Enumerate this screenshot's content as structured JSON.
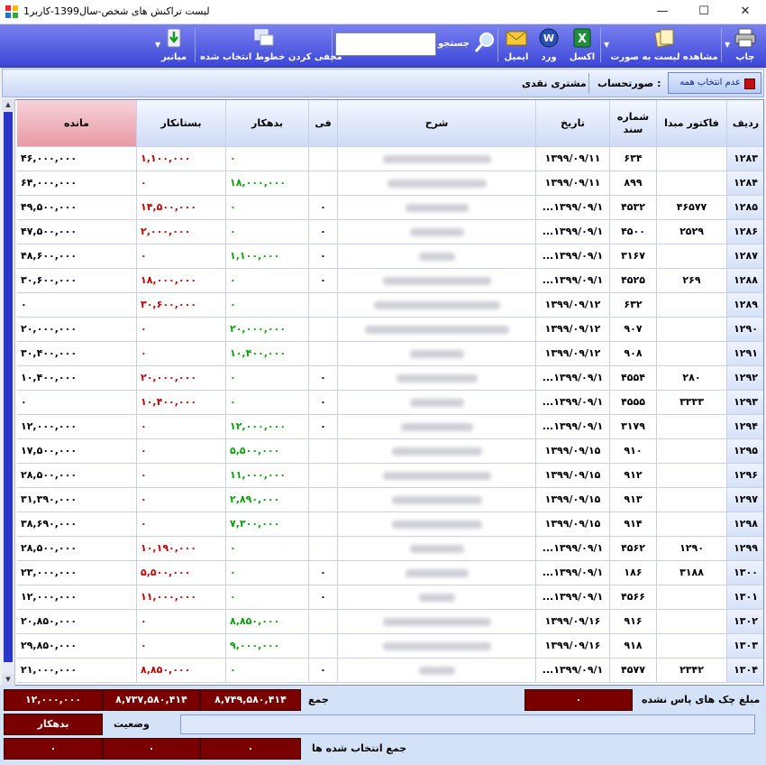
{
  "window": {
    "title": "لیست تراکنش های شخص-سال1399-کاربر1"
  },
  "toolbar": {
    "print": "چاپ",
    "view_list": "مشاهده لیست به صورت",
    "excel": "اکسل",
    "word": "ورد",
    "email": "ایمیل",
    "search_label": "جستجو",
    "search_value": "",
    "hide_selected": "مخفی کردن خطوط انتخاب شده",
    "shortcut": "میانبر"
  },
  "account": {
    "deselect_all": "عدم انتخاب همه",
    "label": "صورتحساب :",
    "value": "مشتری نقدی"
  },
  "table": {
    "headers": {
      "row": "ردیف",
      "factor": "فاکتور مبدا",
      "doc": "شماره سند",
      "date": "تاریخ",
      "desc": "شرح",
      "fee": "فی",
      "debit": "بدهکار",
      "credit": "بستانکار",
      "balance": "مانده"
    },
    "rows": [
      {
        "row": "۱۲۸۳",
        "factor": "",
        "doc": "۶۳۴",
        "date": "۱۳۹۹/۰۹/۱۱",
        "fee": "",
        "debit": "۰",
        "credit": "۱,۱۰۰,۰۰۰",
        "balance": "۴۶,۰۰۰,۰۰۰"
      },
      {
        "row": "۱۲۸۴",
        "factor": "",
        "doc": "۸۹۹",
        "date": "۱۳۹۹/۰۹/۱۱",
        "fee": "",
        "debit": "۱۸,۰۰۰,۰۰۰",
        "credit": "۰",
        "balance": "۶۴,۰۰۰,۰۰۰"
      },
      {
        "row": "۱۲۸۵",
        "factor": "۴۶۵۷۷",
        "doc": "۴۵۳۲",
        "date": "...۱۳۹۹/۰۹/۱",
        "fee": "۰",
        "debit": "۰",
        "credit": "۱۴,۵۰۰,۰۰۰",
        "balance": "۴۹,۵۰۰,۰۰۰"
      },
      {
        "row": "۱۲۸۶",
        "factor": "۲۵۲۹",
        "doc": "۴۵۰۰",
        "date": "...۱۳۹۹/۰۹/۱",
        "fee": "۰",
        "debit": "۰",
        "credit": "۲,۰۰۰,۰۰۰",
        "balance": "۴۷,۵۰۰,۰۰۰"
      },
      {
        "row": "۱۲۸۷",
        "factor": "",
        "doc": "۳۱۶۷",
        "date": "...۱۳۹۹/۰۹/۱",
        "fee": "۰",
        "debit": "۱,۱۰۰,۰۰۰",
        "credit": "۰",
        "balance": "۴۸,۶۰۰,۰۰۰"
      },
      {
        "row": "۱۲۸۸",
        "factor": "۲۶۹",
        "doc": "۴۵۲۵",
        "date": "...۱۳۹۹/۰۹/۱",
        "fee": "۰",
        "debit": "۰",
        "credit": "۱۸,۰۰۰,۰۰۰",
        "balance": "۳۰,۶۰۰,۰۰۰"
      },
      {
        "row": "۱۲۸۹",
        "factor": "",
        "doc": "۶۳۲",
        "date": "۱۳۹۹/۰۹/۱۲",
        "fee": "",
        "debit": "۰",
        "credit": "۳۰,۶۰۰,۰۰۰",
        "balance": "۰"
      },
      {
        "row": "۱۲۹۰",
        "factor": "",
        "doc": "۹۰۷",
        "date": "۱۳۹۹/۰۹/۱۲",
        "fee": "",
        "debit": "۲۰,۰۰۰,۰۰۰",
        "credit": "۰",
        "balance": "۲۰,۰۰۰,۰۰۰"
      },
      {
        "row": "۱۲۹۱",
        "factor": "",
        "doc": "۹۰۸",
        "date": "۱۳۹۹/۰۹/۱۲",
        "fee": "",
        "debit": "۱۰,۴۰۰,۰۰۰",
        "credit": "۰",
        "balance": "۳۰,۴۰۰,۰۰۰"
      },
      {
        "row": "۱۲۹۲",
        "factor": "۲۸۰",
        "doc": "۴۵۵۴",
        "date": "...۱۳۹۹/۰۹/۱",
        "fee": "۰",
        "debit": "۰",
        "credit": "۲۰,۰۰۰,۰۰۰",
        "balance": "۱۰,۴۰۰,۰۰۰"
      },
      {
        "row": "۱۲۹۳",
        "factor": "۳۳۳۳",
        "doc": "۴۵۵۵",
        "date": "...۱۳۹۹/۰۹/۱",
        "fee": "۰",
        "debit": "۰",
        "credit": "۱۰,۴۰۰,۰۰۰",
        "balance": "۰"
      },
      {
        "row": "۱۲۹۴",
        "factor": "",
        "doc": "۳۱۷۹",
        "date": "...۱۳۹۹/۰۹/۱",
        "fee": "۰",
        "debit": "۱۲,۰۰۰,۰۰۰",
        "credit": "۰",
        "balance": "۱۲,۰۰۰,۰۰۰"
      },
      {
        "row": "۱۲۹۵",
        "factor": "",
        "doc": "۹۱۰",
        "date": "۱۳۹۹/۰۹/۱۵",
        "fee": "",
        "debit": "۵,۵۰۰,۰۰۰",
        "credit": "۰",
        "balance": "۱۷,۵۰۰,۰۰۰"
      },
      {
        "row": "۱۲۹۶",
        "factor": "",
        "doc": "۹۱۲",
        "date": "۱۳۹۹/۰۹/۱۵",
        "fee": "",
        "debit": "۱۱,۰۰۰,۰۰۰",
        "credit": "۰",
        "balance": "۲۸,۵۰۰,۰۰۰"
      },
      {
        "row": "۱۲۹۷",
        "factor": "",
        "doc": "۹۱۳",
        "date": "۱۳۹۹/۰۹/۱۵",
        "fee": "",
        "debit": "۲,۸۹۰,۰۰۰",
        "credit": "۰",
        "balance": "۳۱,۳۹۰,۰۰۰"
      },
      {
        "row": "۱۲۹۸",
        "factor": "",
        "doc": "۹۱۴",
        "date": "۱۳۹۹/۰۹/۱۵",
        "fee": "",
        "debit": "۷,۳۰۰,۰۰۰",
        "credit": "۰",
        "balance": "۳۸,۶۹۰,۰۰۰"
      },
      {
        "row": "۱۲۹۹",
        "factor": "۱۲۹۰",
        "doc": "۴۵۶۲",
        "date": "...۱۳۹۹/۰۹/۱",
        "fee": "",
        "debit": "۰",
        "credit": "۱۰,۱۹۰,۰۰۰",
        "balance": "۲۸,۵۰۰,۰۰۰"
      },
      {
        "row": "۱۳۰۰",
        "factor": "۳۱۸۸",
        "doc": "۱۸۶",
        "date": "...۱۳۹۹/۰۹/۱",
        "fee": "۰",
        "debit": "۰",
        "credit": "۵,۵۰۰,۰۰۰",
        "balance": "۲۳,۰۰۰,۰۰۰"
      },
      {
        "row": "۱۳۰۱",
        "factor": "",
        "doc": "۴۵۶۶",
        "date": "...۱۳۹۹/۰۹/۱",
        "fee": "۰",
        "debit": "۰",
        "credit": "۱۱,۰۰۰,۰۰۰",
        "balance": "۱۲,۰۰۰,۰۰۰"
      },
      {
        "row": "۱۳۰۲",
        "factor": "",
        "doc": "۹۱۶",
        "date": "۱۳۹۹/۰۹/۱۶",
        "fee": "",
        "debit": "۸,۸۵۰,۰۰۰",
        "credit": "۰",
        "balance": "۲۰,۸۵۰,۰۰۰"
      },
      {
        "row": "۱۳۰۳",
        "factor": "",
        "doc": "۹۱۸",
        "date": "۱۳۹۹/۰۹/۱۶",
        "fee": "",
        "debit": "۹,۰۰۰,۰۰۰",
        "credit": "۰",
        "balance": "۲۹,۸۵۰,۰۰۰"
      },
      {
        "row": "۱۳۰۴",
        "factor": "۲۳۴۲",
        "doc": "۴۵۷۷",
        "date": "...۱۳۹۹/۰۹/۱",
        "fee": "۰",
        "debit": "۰",
        "credit": "۸,۸۵۰,۰۰۰",
        "balance": "۲۱,۰۰۰,۰۰۰"
      }
    ]
  },
  "footer": {
    "total_label": "جمع",
    "total_debit": "۸,۷۴۹,۵۸۰,۴۱۴",
    "total_credit": "۸,۷۳۷,۵۸۰,۴۱۴",
    "total_balance": "۱۲,۰۰۰,۰۰۰",
    "unpaid_checks_label": "مبلغ چک های پاس نشده",
    "unpaid_checks_value": "۰",
    "status_label": "وضعیت",
    "status_value": "بدهکار",
    "selected_total_label": "جمع انتخاب شده ها",
    "selected_values": [
      "۰",
      "۰",
      "۰"
    ]
  },
  "colors": {
    "accent": "#3b46d6",
    "debit": "#0aa00a",
    "credit": "#c00000",
    "footer_box": "#7a0000"
  }
}
